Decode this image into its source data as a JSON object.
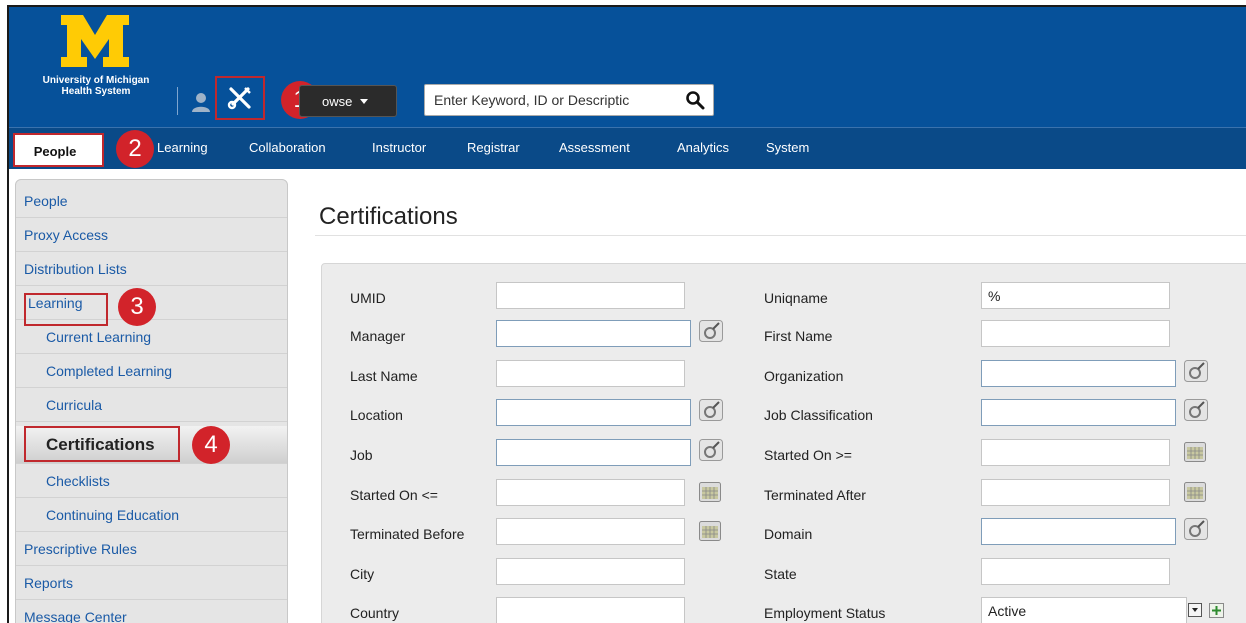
{
  "header": {
    "logo_line1": "University of Michigan",
    "logo_line2": "Health System",
    "browse_label": "owse",
    "search_placeholder": "Enter Keyword, ID or Descriptic"
  },
  "nav": {
    "items": [
      "People",
      "Learning",
      "Collaboration",
      "Instructor",
      "Registrar",
      "Assessment",
      "Analytics",
      "System"
    ]
  },
  "callouts": [
    "1",
    "2",
    "3",
    "4"
  ],
  "sidebar": {
    "items": [
      "People",
      "Proxy Access",
      "Distribution Lists",
      "Learning",
      "Current Learning",
      "Completed Learning",
      "Curricula",
      "Certifications",
      "Checklists",
      "Continuing Education",
      "Prescriptive Rules",
      "Reports",
      "Message Center"
    ]
  },
  "page": {
    "title": "Certifications"
  },
  "form": {
    "left": {
      "umid": "UMID",
      "manager": "Manager",
      "last_name": "Last Name",
      "location": "Location",
      "job": "Job",
      "started_on_le": "Started On <=",
      "terminated_before": "Terminated Before",
      "city": "City",
      "country": "Country"
    },
    "right": {
      "uniqname": "Uniqname",
      "uniqname_value": "%",
      "first_name": "First Name",
      "organization": "Organization",
      "job_classification": "Job Classification",
      "started_on_ge": "Started On >=",
      "terminated_after": "Terminated After",
      "domain": "Domain",
      "state": "State",
      "employment_status": "Employment Status",
      "employment_status_value": "Active"
    }
  },
  "colors": {
    "header_blue": "#06519a",
    "nav_blue": "#0a4a88",
    "callout_red": "#d2232a",
    "link_blue": "#1a5aa6"
  },
  "icons": [
    "block-m-logo",
    "user-icon",
    "tools-icon",
    "chevron-down-icon",
    "search-icon",
    "picker-icon",
    "calendar-icon",
    "add-icon"
  ]
}
